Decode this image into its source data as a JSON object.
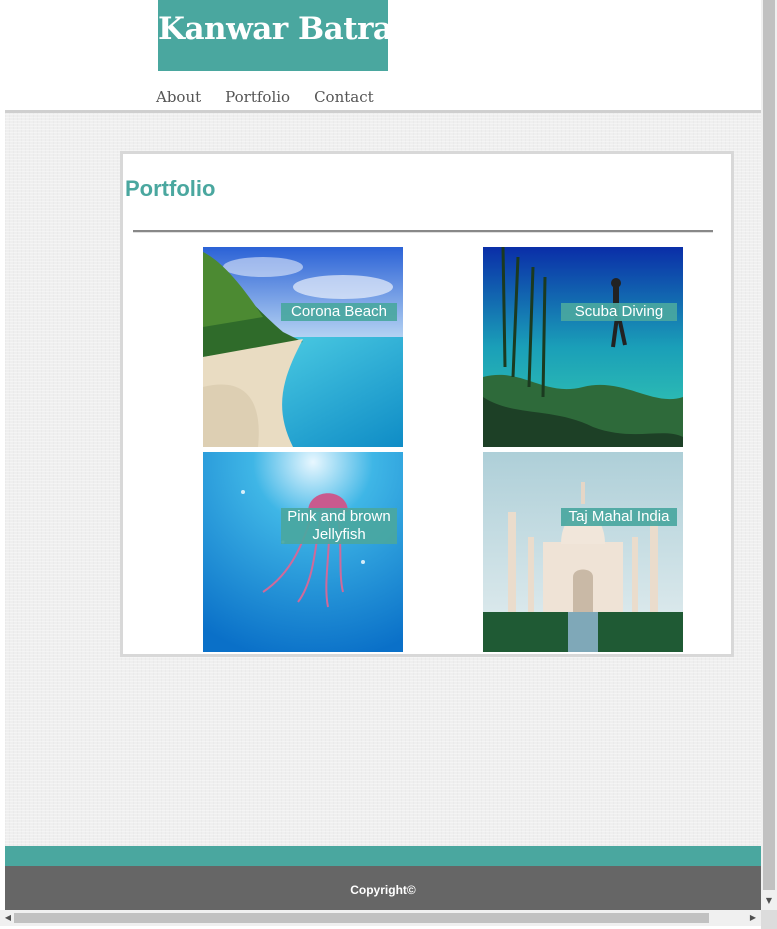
{
  "header": {
    "logo_text": "Kanwar Batra",
    "nav": [
      {
        "label": "About"
      },
      {
        "label": "Portfolio"
      },
      {
        "label": "Contact"
      }
    ]
  },
  "portfolio": {
    "title": "Portfolio",
    "items": [
      {
        "caption": "Corona Beach"
      },
      {
        "caption": "Scuba Diving"
      },
      {
        "caption": "Pink and brown Jellyfish"
      },
      {
        "caption": "Taj Mahal India"
      }
    ]
  },
  "footer": {
    "copyright": "Copyright©"
  },
  "colors": {
    "accent": "#4aa79f",
    "footer": "#666666"
  },
  "icons": {
    "scroll_up": "arrow-up-icon",
    "scroll_down": "arrow-down-icon",
    "scroll_left": "arrow-left-icon",
    "scroll_right": "arrow-right-icon"
  }
}
